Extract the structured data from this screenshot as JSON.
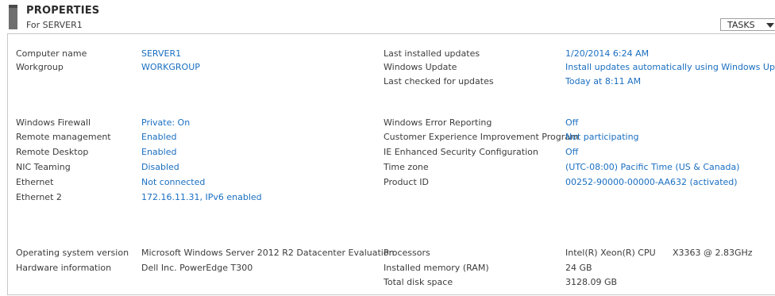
{
  "header": {
    "title": "PROPERTIES",
    "subtitle": "For SERVER1",
    "tasks_label": "TASKS"
  },
  "left": {
    "computer_name": {
      "label": "Computer name",
      "value": "SERVER1"
    },
    "workgroup": {
      "label": "Workgroup",
      "value": "WORKGROUP"
    },
    "windows_firewall": {
      "label": "Windows Firewall",
      "value": "Private: On"
    },
    "remote_management": {
      "label": "Remote management",
      "value": "Enabled"
    },
    "remote_desktop": {
      "label": "Remote Desktop",
      "value": "Enabled"
    },
    "nic_teaming": {
      "label": "NIC Teaming",
      "value": "Disabled"
    },
    "ethernet": {
      "label": "Ethernet",
      "value": "Not connected"
    },
    "ethernet2": {
      "label": "Ethernet 2",
      "value": "172.16.11.31, IPv6 enabled"
    },
    "os_version": {
      "label": "Operating system version",
      "value": "Microsoft Windows Server 2012 R2 Datacenter Evaluation"
    },
    "hardware": {
      "label": "Hardware information",
      "value": "Dell Inc. PowerEdge T300"
    }
  },
  "right": {
    "last_updates": {
      "label": "Last installed updates",
      "value": "1/20/2014 6:24 AM"
    },
    "windows_update": {
      "label": "Windows Update",
      "value": "Install updates automatically using Windows Update"
    },
    "last_checked": {
      "label": "Last checked for updates",
      "value": "Today at 8:11 AM"
    },
    "error_reporting": {
      "label": "Windows Error Reporting",
      "value": "Off"
    },
    "ceip": {
      "label": "Customer Experience Improvement Program",
      "value": "Not participating"
    },
    "ie_esc": {
      "label": "IE Enhanced Security Configuration",
      "value": "Off"
    },
    "time_zone": {
      "label": "Time zone",
      "value": "(UTC-08:00) Pacific Time (US & Canada)"
    },
    "product_id": {
      "label": "Product ID",
      "value": "00252-90000-00000-AA632 (activated)"
    },
    "processors": {
      "label": "Processors",
      "value": "Intel(R) Xeon(R) CPU",
      "value2": "X3363  @ 2.83GHz"
    },
    "memory": {
      "label": "Installed memory (RAM)",
      "value": "24 GB"
    },
    "disk": {
      "label": "Total disk space",
      "value": "3128.09 GB"
    }
  },
  "colors": {
    "link": "#1a6fc1",
    "label": "#3c3c3c",
    "border": "#c8c8c8"
  },
  "icons": {
    "header_icon": "server-tower-icon",
    "dropdown": "chevron-down-icon"
  }
}
